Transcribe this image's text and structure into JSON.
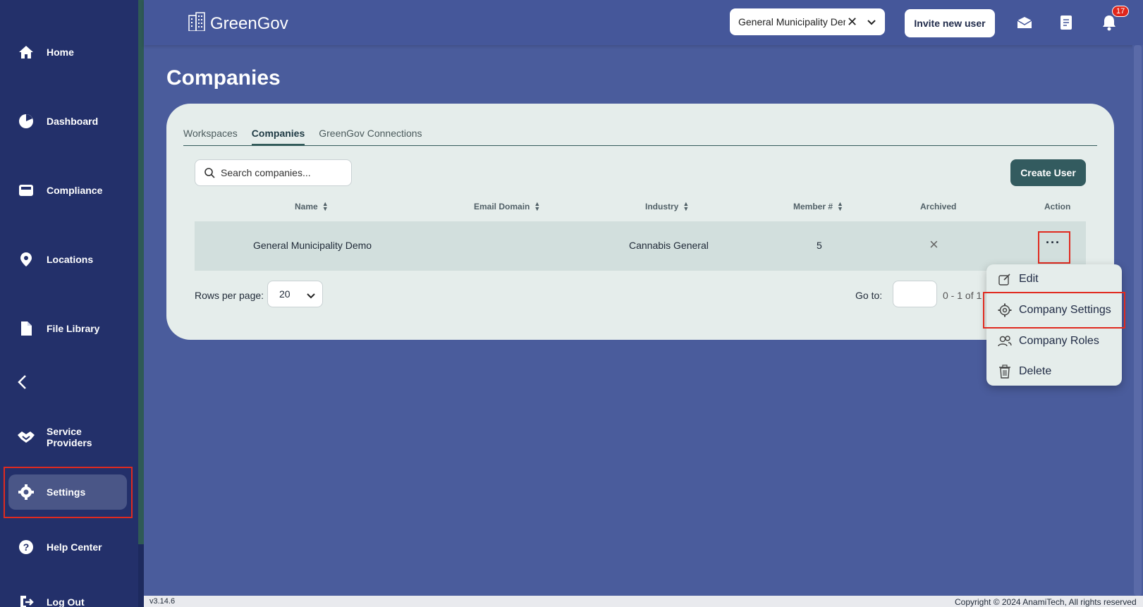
{
  "sidebar": {
    "items": [
      {
        "label": "Home",
        "icon": "home-icon"
      },
      {
        "label": "Dashboard",
        "icon": "pie-chart-icon"
      },
      {
        "label": "Compliance",
        "icon": "inbox-icon"
      },
      {
        "label": "Locations",
        "icon": "location-pin-icon"
      },
      {
        "label": "File Library",
        "icon": "file-icon"
      },
      {
        "label": "Service Providers",
        "icon": "handshake-icon"
      },
      {
        "label": "Settings",
        "icon": "gear-icon"
      },
      {
        "label": "Help Center",
        "icon": "help-icon"
      },
      {
        "label": "Log Out",
        "icon": "logout-icon"
      }
    ]
  },
  "header": {
    "brand": "GreenGov",
    "org_selected": "General Municipality Demo",
    "invite_label": "Invite new user",
    "notification_count": "17"
  },
  "page": {
    "title": "Companies",
    "tabs": [
      "Workspaces",
      "Companies",
      "GreenGov Connections"
    ],
    "active_tab": "Companies",
    "search_placeholder": "Search companies...",
    "create_label": "Create User",
    "table": {
      "columns": [
        "Name",
        "Email Domain",
        "Industry",
        "Member #",
        "Archived",
        "Action"
      ],
      "rows": [
        {
          "name": "General Municipality Demo",
          "email_domain": "",
          "industry": "Cannabis General",
          "members": "5",
          "archived": "×"
        }
      ]
    },
    "pagination": {
      "rows_per_page_label": "Rows per page:",
      "rows_per_page": "20",
      "goto_label": "Go to:",
      "range": "0 - 1 of 1"
    }
  },
  "action_menu": {
    "items": [
      {
        "label": "Edit",
        "icon": "edit-icon"
      },
      {
        "label": "Company Settings",
        "icon": "gear-icon"
      },
      {
        "label": "Company Roles",
        "icon": "users-icon"
      },
      {
        "label": "Delete",
        "icon": "trash-icon"
      }
    ]
  },
  "footer": {
    "version": "v3.14.6",
    "copyright": "Copyright © 2024 AnamiTech, All rights reserved"
  },
  "colors": {
    "sidebar": "#23306a",
    "background": "#4a5c9c",
    "card": "#e5edeb",
    "accent": "#335b5f",
    "highlight": "#e02a1f"
  }
}
